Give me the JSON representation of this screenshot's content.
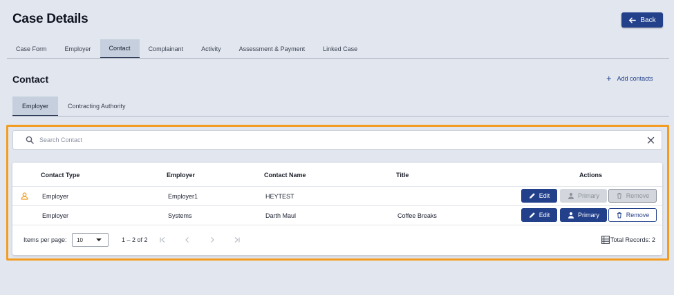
{
  "header": {
    "title": "Case Details",
    "back_label": "Back"
  },
  "tabs": [
    {
      "label": "Case Form"
    },
    {
      "label": "Employer"
    },
    {
      "label": "Contact",
      "active": true
    },
    {
      "label": "Complainant"
    },
    {
      "label": "Activity"
    },
    {
      "label": "Assessment & Payment"
    },
    {
      "label": "Linked Case"
    }
  ],
  "section": {
    "title": "Contact",
    "add_label": "Add contacts"
  },
  "subtabs": [
    {
      "label": "Employer",
      "active": true
    },
    {
      "label": "Contracting Authority"
    }
  ],
  "search": {
    "placeholder": "Search Contact",
    "value": ""
  },
  "table": {
    "columns": [
      "Contact Type",
      "Employer",
      "Contact Name",
      "Title",
      "Actions"
    ],
    "rows": [
      {
        "contact_type": "Employer",
        "employer": "Employer1",
        "contact_name": "HEYTEST",
        "title": "",
        "is_primary": true,
        "actions": {
          "edit": "Edit",
          "primary": "Primary",
          "remove": "Remove",
          "primary_disabled": true,
          "remove_disabled": true
        }
      },
      {
        "contact_type": "Employer",
        "employer": "Systems",
        "contact_name": "Darth Maul",
        "title": "Coffee Breaks",
        "is_primary": false,
        "actions": {
          "edit": "Edit",
          "primary": "Primary",
          "remove": "Remove",
          "primary_disabled": false,
          "remove_disabled": false
        }
      }
    ]
  },
  "pagination": {
    "items_per_page_label": "Items per page:",
    "page_size": "10",
    "range": "1 – 2 of 2",
    "total_records": "Total Records: 2"
  },
  "colors": {
    "background": "#e2e7ef",
    "accent": "#23408b",
    "primary_icon": "#f39c1f",
    "highlight_border": "#f39c1f"
  },
  "icons": {
    "back": "arrow-left-icon",
    "add": "plus-icon",
    "search": "search-icon",
    "clear": "close-icon",
    "primary_contact": "person-icon",
    "edit": "pencil-icon",
    "primary": "person-icon",
    "remove": "trash-icon",
    "first_page": "first-page-icon",
    "prev_page": "chevron-left-icon",
    "next_page": "chevron-right-icon",
    "last_page": "last-page-icon",
    "records": "table-icon"
  }
}
